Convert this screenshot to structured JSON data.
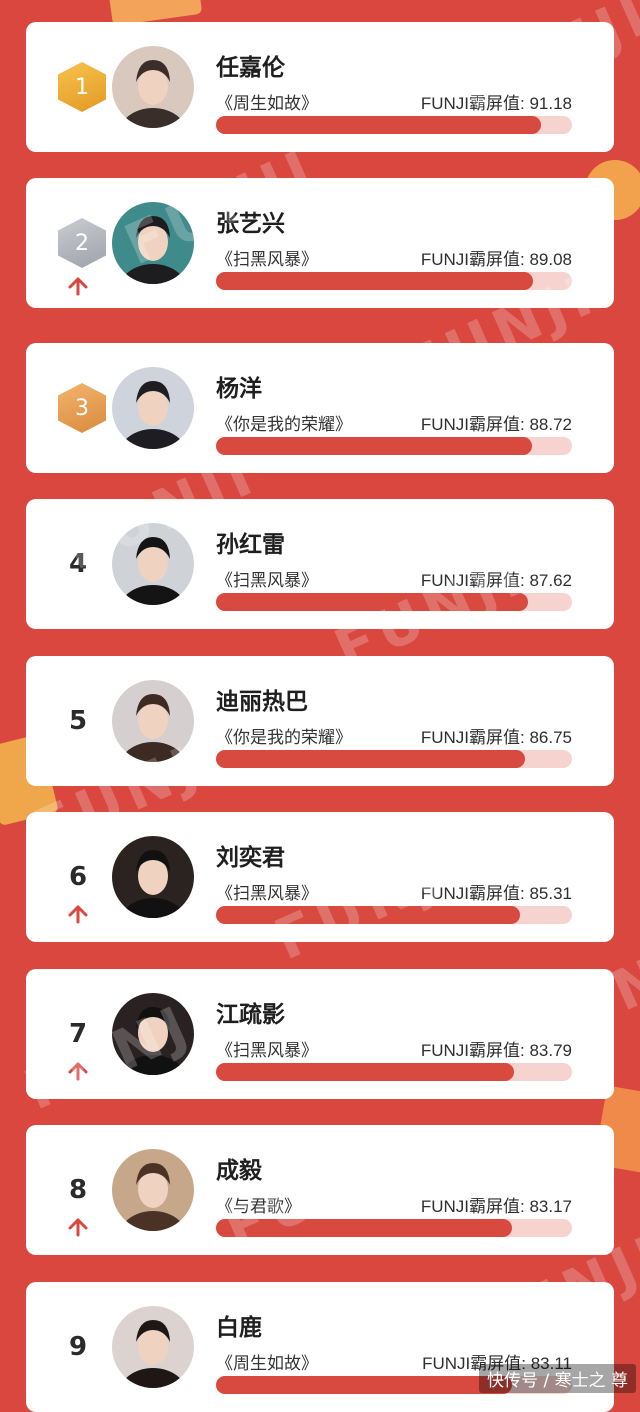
{
  "watermark_text": "FUNJI",
  "entries": [
    {
      "rank": "1",
      "name": "任嘉伦",
      "show": "《周生如故》",
      "score_label": "FUNJI霸屏值: 91.18",
      "score": 91.18,
      "medal": "gold",
      "arrow": false
    },
    {
      "rank": "2",
      "name": "张艺兴",
      "show": "《扫黑风暴》",
      "score_label": "FUNJI霸屏值: 89.08",
      "score": 89.08,
      "medal": "silver",
      "arrow": true
    },
    {
      "rank": "3",
      "name": "杨洋",
      "show": "《你是我的荣耀》",
      "score_label": "FUNJI霸屏值: 88.72",
      "score": 88.72,
      "medal": "bronze",
      "arrow": false
    },
    {
      "rank": "4",
      "name": "孙红雷",
      "show": "《扫黑风暴》",
      "score_label": "FUNJI霸屏值: 87.62",
      "score": 87.62,
      "medal": "",
      "arrow": false
    },
    {
      "rank": "5",
      "name": "迪丽热巴",
      "show": "《你是我的荣耀》",
      "score_label": "FUNJI霸屏值: 86.75",
      "score": 86.75,
      "medal": "",
      "arrow": false
    },
    {
      "rank": "6",
      "name": "刘奕君",
      "show": "《扫黑风暴》",
      "score_label": "FUNJI霸屏值: 85.31",
      "score": 85.31,
      "medal": "",
      "arrow": true
    },
    {
      "rank": "7",
      "name": "江疏影",
      "show": "《扫黑风暴》",
      "score_label": "FUNJI霸屏值: 83.79",
      "score": 83.79,
      "medal": "",
      "arrow": true
    },
    {
      "rank": "8",
      "name": "成毅",
      "show": "《与君歌》",
      "score_label": "FUNJI霸屏值: 83.17",
      "score": 83.17,
      "medal": "",
      "arrow": true
    },
    {
      "rank": "9",
      "name": "白鹿",
      "show": "《周生如故》",
      "score_label": "FUNJI霸屏值: 83.11",
      "score": 83.11,
      "medal": "",
      "arrow": false
    }
  ],
  "footer": "快传号 / 寒士之 尊",
  "colors": {
    "background": "#d9473f",
    "bar": "#d8493f",
    "bar_track": "#f6d3cf",
    "arrow": "#d9473f"
  }
}
